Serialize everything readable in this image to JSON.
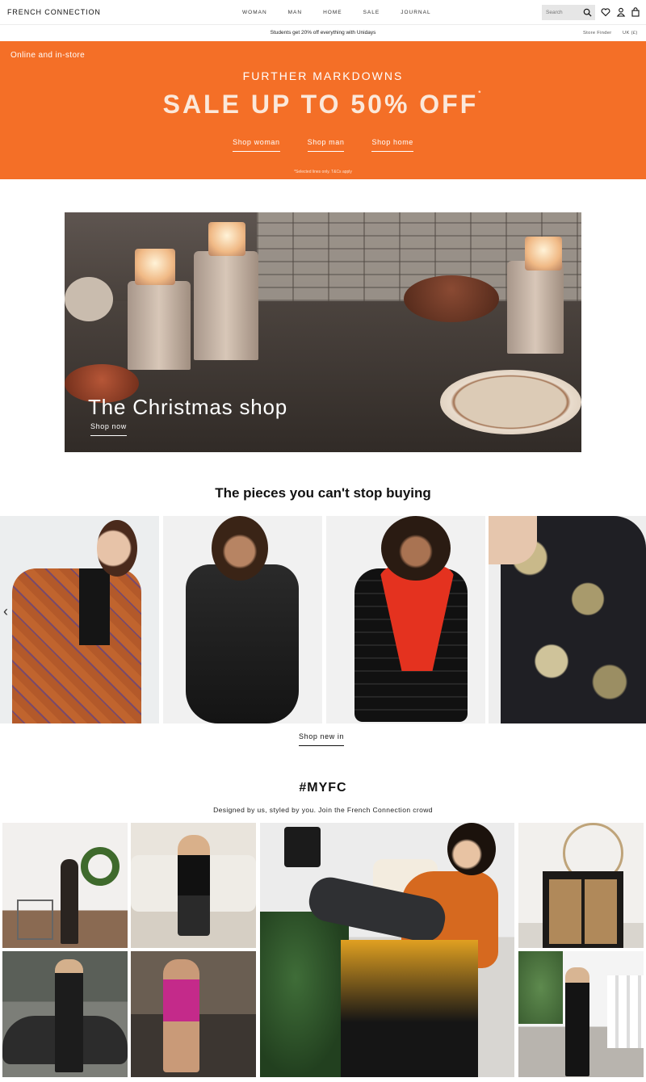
{
  "header": {
    "logo": "FRENCH CONNECTION",
    "nav": [
      "WOMAN",
      "MAN",
      "HOME",
      "SALE",
      "JOURNAL"
    ],
    "search_placeholder": "Search",
    "icons": [
      "search-icon",
      "heart-icon",
      "account-icon",
      "bag-icon"
    ]
  },
  "promo": {
    "text": "Students get 20% off everything with Unidays",
    "store_finder": "Store Finder",
    "locale": "UK (£)"
  },
  "sale": {
    "tag": "Online and in-store",
    "subtitle": "FURTHER MARKDOWNS",
    "title": "SALE UP TO 50% OFF",
    "title_mark": "*",
    "links": [
      "Shop woman",
      "Shop man",
      "Shop home"
    ],
    "note": "*Selected lines only. T&Cs apply",
    "color": "#f46f27"
  },
  "hero": {
    "title": "The Christmas shop",
    "cta": "Shop now"
  },
  "products": {
    "title": "The pieces you can't stop buying",
    "cta": "Shop new in",
    "prev_arrow": "‹"
  },
  "myfc": {
    "title": "#MYFC",
    "subtitle": "Designed by us, styled by you. Join the French Connection crowd"
  }
}
